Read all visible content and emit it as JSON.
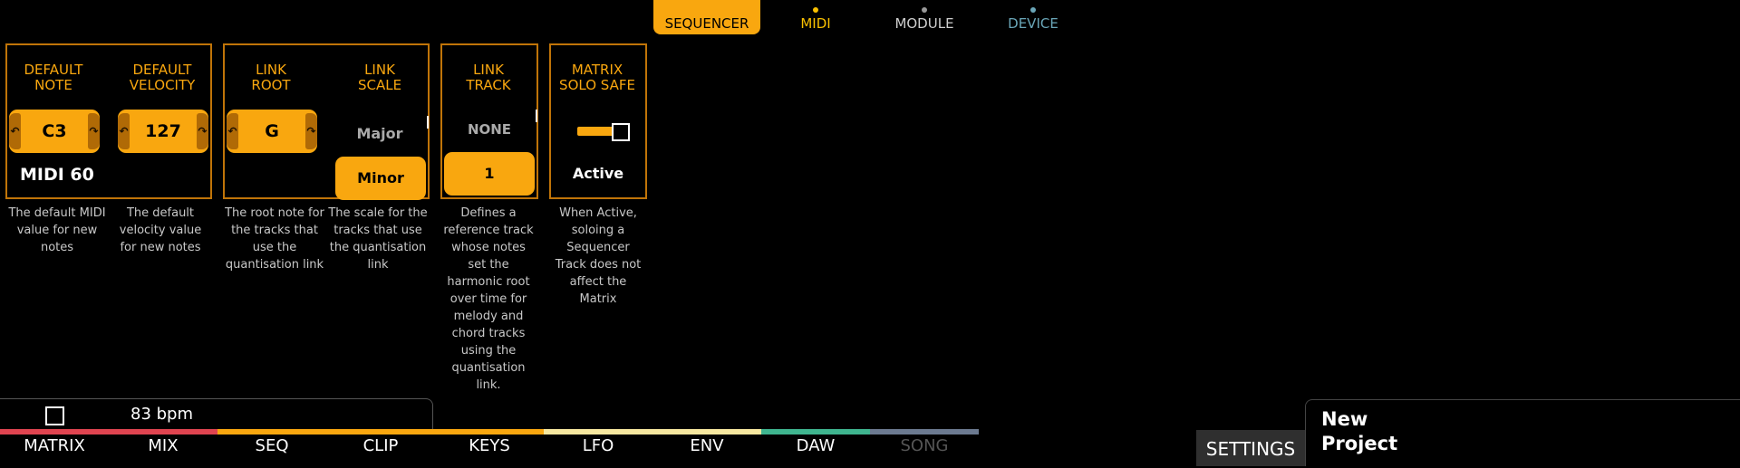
{
  "top_tabs": [
    {
      "label": "SEQUENCER",
      "active": true,
      "dot_color": ""
    },
    {
      "label": "MIDI",
      "active": false,
      "dot_color": "#f9c000",
      "text_color": "#f9c000"
    },
    {
      "label": "MODULE",
      "active": false,
      "dot_color": "#999999",
      "text_color": "#cfcfcf"
    },
    {
      "label": "DEVICE",
      "active": false,
      "dot_color": "#6aa6b8",
      "text_color": "#6aa6b8"
    }
  ],
  "panels": {
    "default_note": {
      "label": "DEFAULT\nNOTE",
      "value": "C3",
      "sub": "MIDI 60",
      "desc": "The default MIDI value for new notes"
    },
    "default_velocity": {
      "label": "DEFAULT\nVELOCITY",
      "value": "127",
      "desc": "The default velocity value for new notes"
    },
    "link_root": {
      "label": "LINK\nROOT",
      "value": "G",
      "desc": "The root note for the tracks that use the quantisation link"
    },
    "link_scale": {
      "label": "LINK\nSCALE",
      "options": [
        "Major",
        "Minor"
      ],
      "selected": "Minor",
      "desc": "The scale for the tracks that use the quantisation link"
    },
    "link_track": {
      "label": "LINK\nTRACK",
      "options": [
        "NONE",
        "1"
      ],
      "selected": "1",
      "desc": "Defines a reference track whose notes set the harmonic root over time for melody and chord tracks using the quantisation link."
    },
    "matrix_solo_safe": {
      "label": "MATRIX\nSOLO SAFE",
      "toggle": "on",
      "state": "Active",
      "desc": "When Active, soloing a Sequencer Track does not affect the Matrix"
    }
  },
  "transport": {
    "bpm": "83 bpm"
  },
  "nav": {
    "items": [
      {
        "label": "MATRIX",
        "color": "#e04450"
      },
      {
        "label": "MIX",
        "color": "#e04450"
      },
      {
        "label": "SEQ",
        "color": "#f9a70f"
      },
      {
        "label": "CLIP",
        "color": "#f9a70f"
      },
      {
        "label": "KEYS",
        "color": "#f9a70f"
      },
      {
        "label": "LFO",
        "color": "#f7e8a0"
      },
      {
        "label": "ENV",
        "color": "#f7e8a0"
      },
      {
        "label": "DAW",
        "color": "#3fb58f"
      },
      {
        "label": "SONG",
        "color": "#6c7a90",
        "dim": true
      }
    ]
  },
  "settings": {
    "label": "SETTINGS"
  },
  "project": {
    "name": "New\nProject"
  }
}
